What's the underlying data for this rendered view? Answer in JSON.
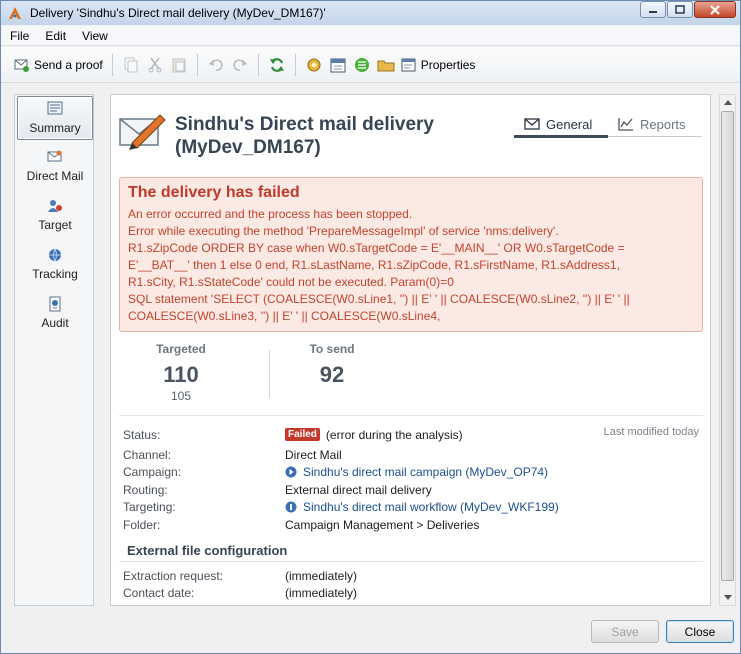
{
  "window": {
    "title": "Delivery 'Sindhu's Direct mail delivery (MyDev_DM167)'"
  },
  "menu": [
    "File",
    "Edit",
    "View"
  ],
  "toolbar": {
    "send_proof": "Send a proof",
    "properties": "Properties"
  },
  "nav": [
    {
      "label": "Summary",
      "icon": "summary-icon",
      "active": true
    },
    {
      "label": "Direct Mail",
      "icon": "direct-mail-icon",
      "active": false
    },
    {
      "label": "Target",
      "icon": "target-icon",
      "active": false
    },
    {
      "label": "Tracking",
      "icon": "tracking-icon",
      "active": false
    },
    {
      "label": "Audit",
      "icon": "audit-icon",
      "active": false
    }
  ],
  "header": {
    "title_line1": "Sindhu's Direct mail delivery",
    "title_line2": "(MyDev_DM167)",
    "icon": "direct-mail-pen-icon"
  },
  "tabs": [
    {
      "label": "General",
      "icon": "envelope-icon",
      "active": true
    },
    {
      "label": "Reports",
      "icon": "chart-line-icon",
      "active": false
    }
  ],
  "error": {
    "title": "The delivery has failed",
    "lines": [
      "An error occurred and the process has been stopped.",
      "Error while executing the method 'PrepareMessageImpl' of service 'nms:delivery'.",
      "R1.sZipCode ORDER BY case when W0.sTargetCode = E'__MAIN__' OR W0.sTargetCode =",
      "E'__BAT__' then 1 else 0 end, R1.sLastName, R1.sZipCode, R1.sFirstName, R1.sAddress1,",
      "R1.sCity, R1.sStateCode' could not be executed. Param(0)=0",
      "SQL statement 'SELECT (COALESCE(W0.sLine1, '') || E' ' || COALESCE(W0.sLine2, '') || E' ' ||",
      "COALESCE(W0.sLine3, '') || E' ' || COALESCE(W0.sLine4,"
    ]
  },
  "stats": {
    "targeted_label": "Targeted",
    "targeted_value": "110",
    "targeted_sub": "105",
    "to_send_label": "To send",
    "to_send_value": "92"
  },
  "details": {
    "status_label": "Status:",
    "status_badge": "Failed",
    "status_text": "(error during the analysis)",
    "last_modified": "Last modified today",
    "channel_label": "Channel:",
    "channel_value": "Direct Mail",
    "campaign_label": "Campaign:",
    "campaign_value": "Sindhu's direct mail campaign (MyDev_OP74)",
    "routing_label": "Routing:",
    "routing_value": "External direct mail delivery",
    "targeting_label": "Targeting:",
    "targeting_value": "Sindhu's direct mail workflow (MyDev_WKF199)",
    "folder_label": "Folder:",
    "folder_value": "Campaign Management > Deliveries"
  },
  "external": {
    "section_title": "External file configuration",
    "extraction_label": "Extraction request:",
    "extraction_value": "(immediately)",
    "contact_label": "Contact date:",
    "contact_value": "(immediately)"
  },
  "footer": {
    "save": "Save",
    "close": "Close"
  },
  "colors": {
    "error_text": "#c4432e",
    "error_bg": "#fbe9e3",
    "badge_failed": "#c0392b",
    "link": "#1d4f8f"
  }
}
